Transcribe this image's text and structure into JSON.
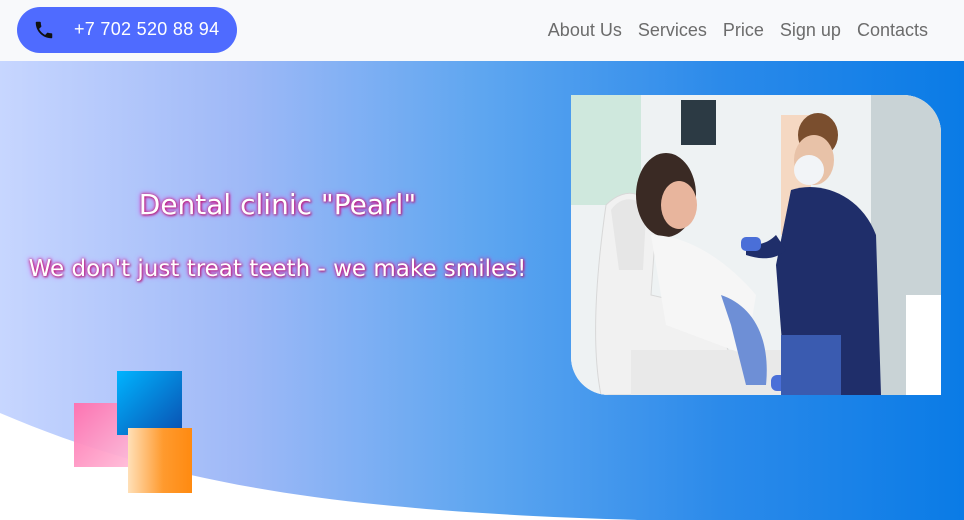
{
  "header": {
    "phone": {
      "icon": "phone-icon",
      "number": "+7 702 520 88 94"
    },
    "nav": [
      {
        "label": "About Us"
      },
      {
        "label": "Services"
      },
      {
        "label": "Price"
      },
      {
        "label": "Sign up"
      },
      {
        "label": "Contacts"
      }
    ]
  },
  "hero": {
    "title": "Dental clinic \"Pearl\"",
    "slogan": "We don't just treat teeth - we make smiles!",
    "photo_subject": "dentist treating a patient in a dental chair"
  },
  "colors": {
    "accent": "#4f6bff",
    "hero_gradient_start": "#c7d6ff",
    "hero_gradient_end": "#0a7be6",
    "nav_text": "#6c6c6c"
  }
}
